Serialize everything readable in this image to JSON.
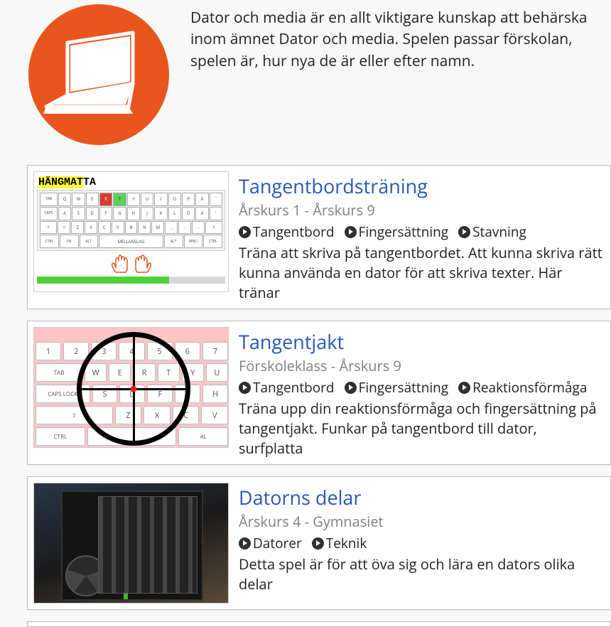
{
  "intro": {
    "text": "Dator och media är en allt viktigare kunskap att behärska inom ämnet Dator och media. Spelen passar förskolan, spelen är, hur nya de är eller efter namn.",
    "logo_alt": "laptop-icon",
    "logo_color": "#e8561e"
  },
  "items": [
    {
      "title": "Tangentbordsträning",
      "grades": "Årskurs 1 - Årskurs 9",
      "tags": [
        "Tangentbord",
        "Fingersättning",
        "Stavning"
      ],
      "description": "Träna att skriva på tangentbordet. Att kunna skriva rätt kunna använda en dator för att skriva texter. Här tränar",
      "thumb": {
        "type": "keyboard",
        "label_highlight": "HÄNGMAT",
        "label_rest": "TA"
      }
    },
    {
      "title": "Tangentjakt",
      "grades": "Förskoleklass - Årskurs 9",
      "tags": [
        "Tangentbord",
        "Fingersättning",
        "Reaktionsförmåga"
      ],
      "description": "Träna upp din reaktionsförmåga och fingersättning på tangentjakt. Funkar på tangentbord till dator, surfplatta",
      "thumb": {
        "type": "sniper"
      }
    },
    {
      "title": "Datorns delar",
      "grades": "Årskurs 4 - Gymnasiet",
      "tags": [
        "Datorer",
        "Teknik"
      ],
      "description": "Detta spel är för att öva sig och lära en dators olika delar",
      "thumb": {
        "type": "pcphoto"
      }
    }
  ]
}
